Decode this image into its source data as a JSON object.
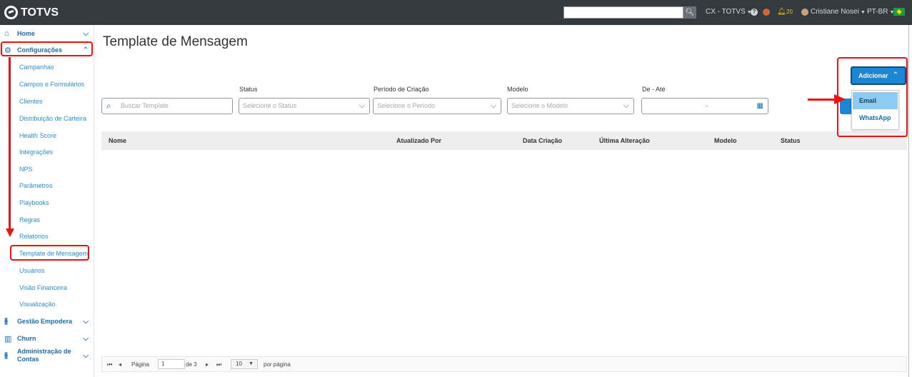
{
  "topbar": {
    "logo_text": "TOTVS",
    "search_placeholder": "",
    "env_label": "CX - TOTVS",
    "notification_count": "20",
    "user_name": "Cristiane Nosei",
    "language": "PT-BR"
  },
  "sidebar": {
    "home": "Home",
    "configuracoes": "Configurações",
    "items": [
      "Campanhas",
      "Campos e Formulários",
      "Clientes",
      "Distribuição de Carteira",
      "Health Score",
      "Integrações",
      "NPS",
      "Parâmetros",
      "Playbooks",
      "Regras",
      "Relatórios",
      "Template de Mensagem",
      "Usuários",
      "Visão Financeira",
      "Visualização"
    ],
    "gestao": "Gestão Empodera",
    "churn": "Churn",
    "admin_line1": "Administração de",
    "admin_line2": "Contas"
  },
  "page": {
    "title": "Template de Mensagem"
  },
  "filters": {
    "search_placeholder": "Buscar Template",
    "status_label": "Status",
    "status_placeholder": "Selecione o Status",
    "periodo_label": "Período de Criação",
    "periodo_placeholder": "Selecione o Período",
    "modelo_label": "Modelo",
    "modelo_placeholder": "Selecione o Modelo",
    "de_ate_label": "De - Até",
    "de_ate_value": "-"
  },
  "table": {
    "columns": [
      "Nome",
      "Atualizado Por",
      "Data Criação",
      "Última Alteração",
      "Modelo",
      "Status"
    ]
  },
  "pagination": {
    "page_label": "Página",
    "page_value": "1",
    "of_total": "de 3",
    "page_size": "10",
    "per_page_label": "por página"
  },
  "add_menu": {
    "button_label": "Adicionar",
    "options": [
      "Email",
      "WhatsApp"
    ]
  },
  "colors": {
    "accent": "#1a86d4",
    "topbar": "#353a41",
    "highlight": "#e11111"
  }
}
